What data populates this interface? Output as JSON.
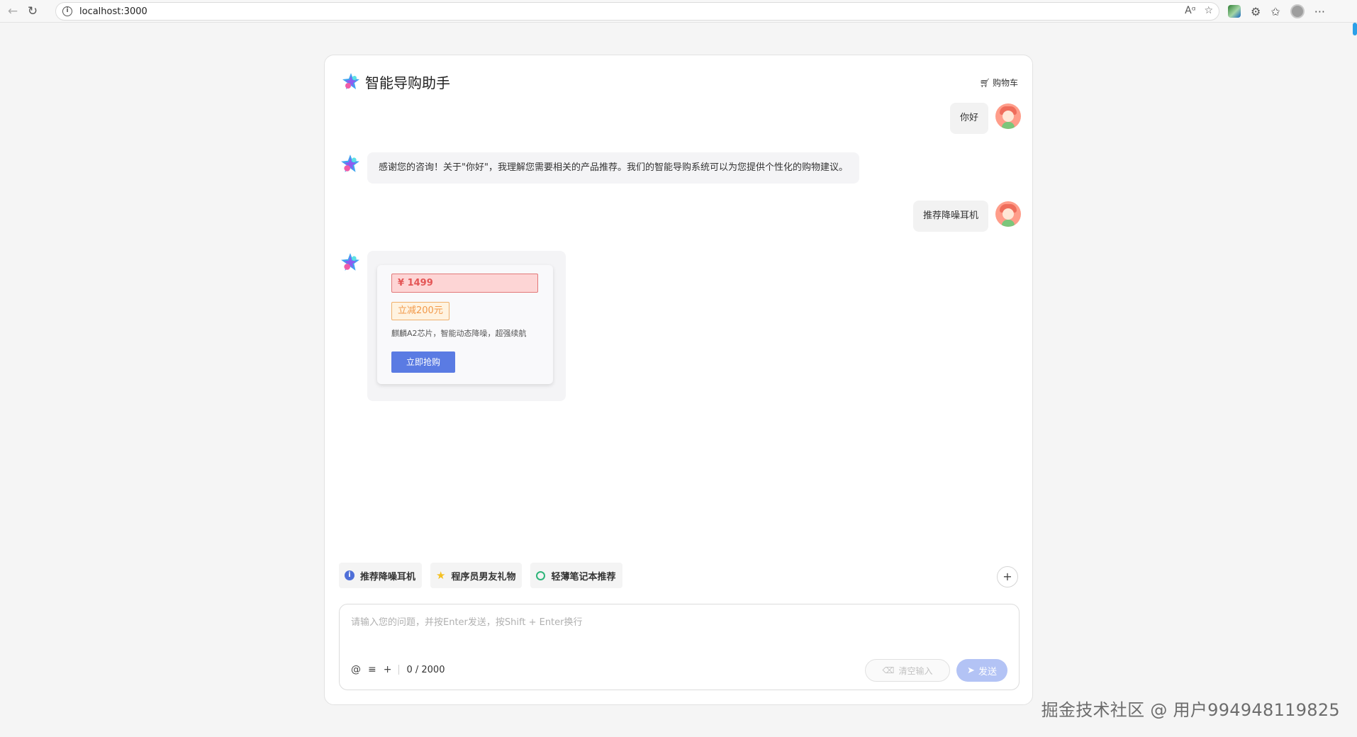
{
  "browser": {
    "url": "localhost:3000"
  },
  "header": {
    "title": "智能导购助手",
    "cart_label": "购物车"
  },
  "messages": [
    {
      "role": "user",
      "text": "你好"
    },
    {
      "role": "assistant",
      "text": "感谢您的咨询！关于\"你好\"，我理解您需要相关的产品推荐。我们的智能导购系统可以为您提供个性化的购物建议。"
    },
    {
      "role": "user",
      "text": "推荐降噪耳机"
    }
  ],
  "product": {
    "price": "¥ 1499",
    "discount": "立减200元",
    "description": "麒麟A2芯片，智能动态降噪，超强续航",
    "buy_label": "立即抢购"
  },
  "quick_prompts": [
    {
      "label": "推荐降噪耳机",
      "icon": "info-icon"
    },
    {
      "label": "程序员男友礼物",
      "icon": "star-icon"
    },
    {
      "label": "轻薄笔记本推荐",
      "icon": "ring-icon"
    }
  ],
  "input": {
    "placeholder": "请输入您的问题，并按Enter发送，按Shift + Enter换行",
    "value": "",
    "counter": "0 / 2000",
    "clear_label": "清空输入",
    "send_label": "发送"
  },
  "watermark": "掘金技术社区 @ 用户994948119825",
  "colors": {
    "accent": "#5a7be3",
    "price_bg": "#fdd5d5",
    "price_text": "#e45656",
    "discount_text": "#f2994a",
    "send_disabled": "#b3c3f5"
  }
}
